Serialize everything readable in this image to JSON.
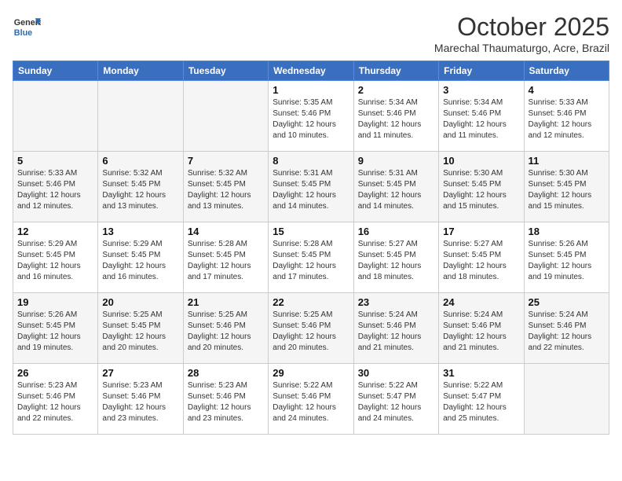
{
  "logo": {
    "general": "General",
    "blue": "Blue"
  },
  "title": "October 2025",
  "subtitle": "Marechal Thaumaturgo, Acre, Brazil",
  "weekdays": [
    "Sunday",
    "Monday",
    "Tuesday",
    "Wednesday",
    "Thursday",
    "Friday",
    "Saturday"
  ],
  "rows": [
    [
      {
        "day": "",
        "info": ""
      },
      {
        "day": "",
        "info": ""
      },
      {
        "day": "",
        "info": ""
      },
      {
        "day": "1",
        "info": "Sunrise: 5:35 AM\nSunset: 5:46 PM\nDaylight: 12 hours\nand 10 minutes."
      },
      {
        "day": "2",
        "info": "Sunrise: 5:34 AM\nSunset: 5:46 PM\nDaylight: 12 hours\nand 11 minutes."
      },
      {
        "day": "3",
        "info": "Sunrise: 5:34 AM\nSunset: 5:46 PM\nDaylight: 12 hours\nand 11 minutes."
      },
      {
        "day": "4",
        "info": "Sunrise: 5:33 AM\nSunset: 5:46 PM\nDaylight: 12 hours\nand 12 minutes."
      }
    ],
    [
      {
        "day": "5",
        "info": "Sunrise: 5:33 AM\nSunset: 5:46 PM\nDaylight: 12 hours\nand 12 minutes."
      },
      {
        "day": "6",
        "info": "Sunrise: 5:32 AM\nSunset: 5:45 PM\nDaylight: 12 hours\nand 13 minutes."
      },
      {
        "day": "7",
        "info": "Sunrise: 5:32 AM\nSunset: 5:45 PM\nDaylight: 12 hours\nand 13 minutes."
      },
      {
        "day": "8",
        "info": "Sunrise: 5:31 AM\nSunset: 5:45 PM\nDaylight: 12 hours\nand 14 minutes."
      },
      {
        "day": "9",
        "info": "Sunrise: 5:31 AM\nSunset: 5:45 PM\nDaylight: 12 hours\nand 14 minutes."
      },
      {
        "day": "10",
        "info": "Sunrise: 5:30 AM\nSunset: 5:45 PM\nDaylight: 12 hours\nand 15 minutes."
      },
      {
        "day": "11",
        "info": "Sunrise: 5:30 AM\nSunset: 5:45 PM\nDaylight: 12 hours\nand 15 minutes."
      }
    ],
    [
      {
        "day": "12",
        "info": "Sunrise: 5:29 AM\nSunset: 5:45 PM\nDaylight: 12 hours\nand 16 minutes."
      },
      {
        "day": "13",
        "info": "Sunrise: 5:29 AM\nSunset: 5:45 PM\nDaylight: 12 hours\nand 16 minutes."
      },
      {
        "day": "14",
        "info": "Sunrise: 5:28 AM\nSunset: 5:45 PM\nDaylight: 12 hours\nand 17 minutes."
      },
      {
        "day": "15",
        "info": "Sunrise: 5:28 AM\nSunset: 5:45 PM\nDaylight: 12 hours\nand 17 minutes."
      },
      {
        "day": "16",
        "info": "Sunrise: 5:27 AM\nSunset: 5:45 PM\nDaylight: 12 hours\nand 18 minutes."
      },
      {
        "day": "17",
        "info": "Sunrise: 5:27 AM\nSunset: 5:45 PM\nDaylight: 12 hours\nand 18 minutes."
      },
      {
        "day": "18",
        "info": "Sunrise: 5:26 AM\nSunset: 5:45 PM\nDaylight: 12 hours\nand 19 minutes."
      }
    ],
    [
      {
        "day": "19",
        "info": "Sunrise: 5:26 AM\nSunset: 5:45 PM\nDaylight: 12 hours\nand 19 minutes."
      },
      {
        "day": "20",
        "info": "Sunrise: 5:25 AM\nSunset: 5:45 PM\nDaylight: 12 hours\nand 20 minutes."
      },
      {
        "day": "21",
        "info": "Sunrise: 5:25 AM\nSunset: 5:46 PM\nDaylight: 12 hours\nand 20 minutes."
      },
      {
        "day": "22",
        "info": "Sunrise: 5:25 AM\nSunset: 5:46 PM\nDaylight: 12 hours\nand 20 minutes."
      },
      {
        "day": "23",
        "info": "Sunrise: 5:24 AM\nSunset: 5:46 PM\nDaylight: 12 hours\nand 21 minutes."
      },
      {
        "day": "24",
        "info": "Sunrise: 5:24 AM\nSunset: 5:46 PM\nDaylight: 12 hours\nand 21 minutes."
      },
      {
        "day": "25",
        "info": "Sunrise: 5:24 AM\nSunset: 5:46 PM\nDaylight: 12 hours\nand 22 minutes."
      }
    ],
    [
      {
        "day": "26",
        "info": "Sunrise: 5:23 AM\nSunset: 5:46 PM\nDaylight: 12 hours\nand 22 minutes."
      },
      {
        "day": "27",
        "info": "Sunrise: 5:23 AM\nSunset: 5:46 PM\nDaylight: 12 hours\nand 23 minutes."
      },
      {
        "day": "28",
        "info": "Sunrise: 5:23 AM\nSunset: 5:46 PM\nDaylight: 12 hours\nand 23 minutes."
      },
      {
        "day": "29",
        "info": "Sunrise: 5:22 AM\nSunset: 5:46 PM\nDaylight: 12 hours\nand 24 minutes."
      },
      {
        "day": "30",
        "info": "Sunrise: 5:22 AM\nSunset: 5:47 PM\nDaylight: 12 hours\nand 24 minutes."
      },
      {
        "day": "31",
        "info": "Sunrise: 5:22 AM\nSunset: 5:47 PM\nDaylight: 12 hours\nand 25 minutes."
      },
      {
        "day": "",
        "info": ""
      }
    ]
  ]
}
